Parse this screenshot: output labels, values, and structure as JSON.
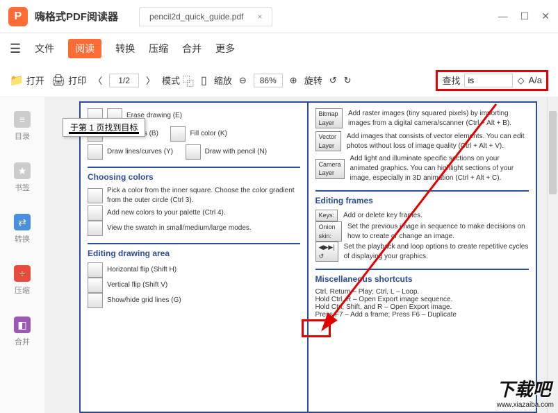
{
  "app": {
    "name": "嗨格式PDF阅读器",
    "logo": "P"
  },
  "tab": {
    "filename": "pencil2d_quick_guide.pdf"
  },
  "win": {
    "min": "—",
    "max": "☐",
    "close": "✕"
  },
  "menu": {
    "file": "文件",
    "read": "阅读",
    "convert": "转换",
    "compress": "压缩",
    "merge": "合并",
    "more": "更多"
  },
  "toolbar": {
    "open": "打开",
    "print": "打印",
    "page": "1/2",
    "mode": "模式",
    "zoom": "缩放",
    "zoomval": "86%",
    "rotate": "旋转",
    "find": "查找",
    "findval": "is",
    "case": "A/a"
  },
  "side": {
    "toc": "目录",
    "bookmark": "书签",
    "convert": "转换",
    "compress": "压缩",
    "merge": "合并"
  },
  "tooltip": "于第 1 页找到目标",
  "doc": {
    "left": {
      "r1": "Erase drawing (E)",
      "r2": "Paint strokes (B)",
      "r3": "Fill color (K)",
      "r4": "Draw lines/curves (Y)",
      "r5": "Draw with pencil (N)",
      "sec1": "Choosing colors",
      "c1": "Pick a color from the inner square. Choose the color gradient from the outer circle (Ctrl 3).",
      "c2": "Add new colors to your palette (Ctrl 4).",
      "c3": "View the swatch in small/medium/large modes.",
      "sec2": "Editing drawing area",
      "d1": "Horizontal flip (Shift H)",
      "d2": "Vertical flip (Shift V)",
      "d3": "Show/hide grid lines (G)"
    },
    "right": {
      "b1": "Bitmap Layer",
      "t1": "Add raster images (tiny squared pixels) by importing images from a digital camera/scanner (Ctrl + Alt + B).",
      "b2": "Vector Layer",
      "t2": "Add images that consists of vector elements. You can edit photos without loss of image quality (Ctrl + Alt + V).",
      "b3": "Camera Layer",
      "t3": "Add light and illuminate specific sections on your animated graphics. You can highlight sections of your image, especially in 3D animation (Ctrl + Alt + C).",
      "sec1": "Editing frames",
      "bk": "Keys:",
      "e1": "Add or delete key frames.",
      "bo": "Onion skin:",
      "e2": "Set the previous image in sequence to make decisions on how to create or change an image.",
      "e3": "Set the playback and loop options to create repetitive cycles of displaying your graphics.",
      "sec2": "Miscellaneous shortcuts",
      "m1": "Ctrl, Return – Play; Ctrl, L – Loop.",
      "m2": "Hold Ctrl, R – Open Export image sequence.",
      "m3": "Hold Ctrl, Shift, and R – Open Export image.",
      "m4": "Press F7 – Add a frame; Press F6 – Duplicate"
    }
  },
  "watermark": {
    "big": "下载吧",
    "url": "www.xiazaiba.com"
  }
}
